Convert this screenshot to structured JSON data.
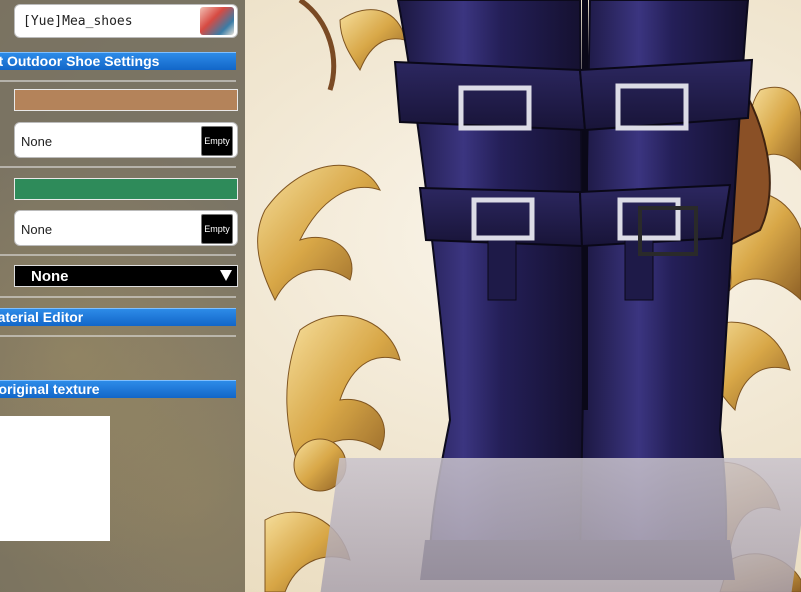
{
  "item": {
    "name": "[Yue]Mea_shoes"
  },
  "sections": {
    "shoe_settings": "ult Outdoor Shoe Settings",
    "material_editor": "Material Editor",
    "original_texture": "p original texture"
  },
  "colors": {
    "swatch1": "#b4835a",
    "swatch2": "#2e8b5a",
    "header": "#1f7ad9"
  },
  "texture_fields": [
    {
      "value": "None",
      "button": "Empty"
    },
    {
      "value": "None",
      "button": "Empty"
    }
  ],
  "dropdown": {
    "selected": "None"
  }
}
